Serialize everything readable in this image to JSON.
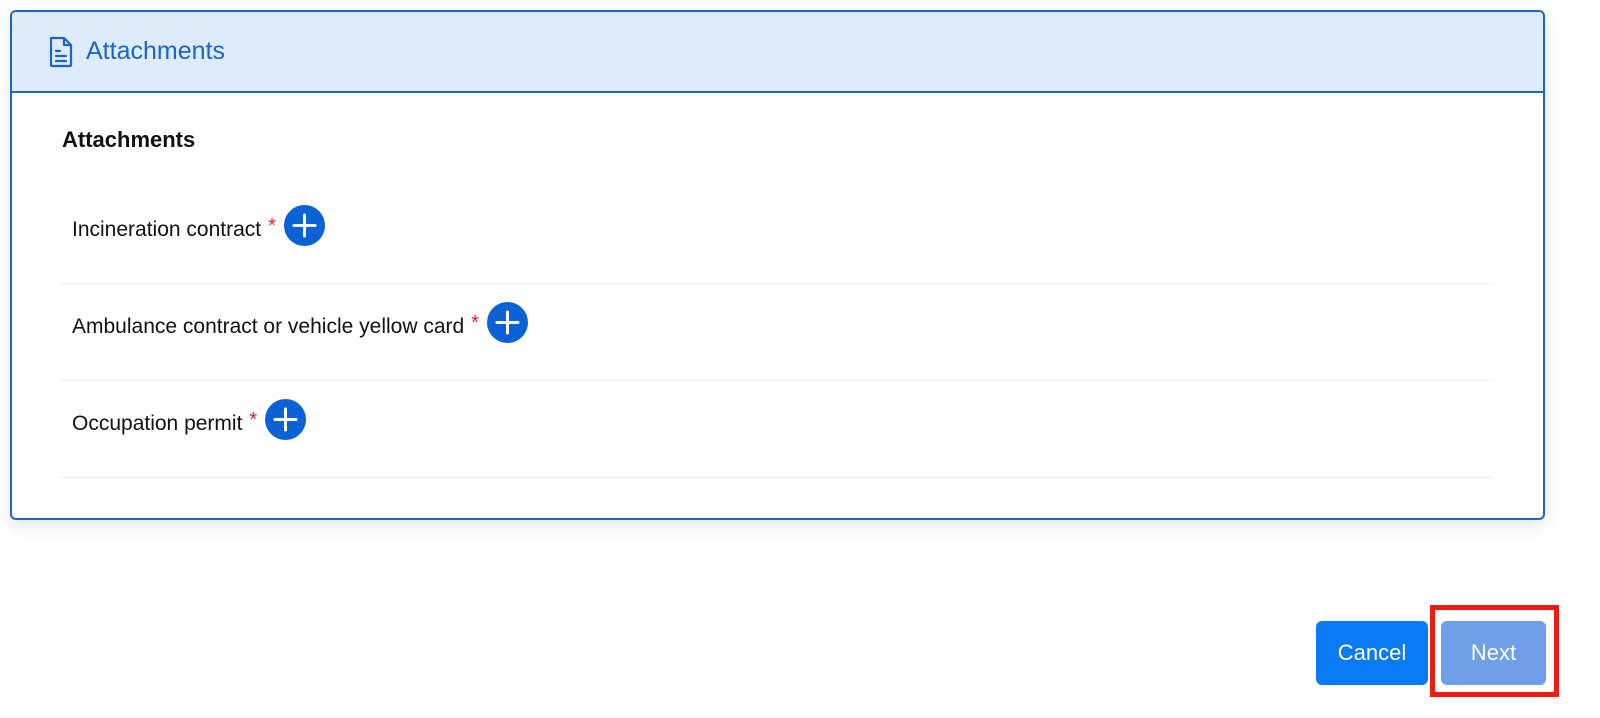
{
  "panel": {
    "header_title": "Attachments",
    "header_icon": "document-icon",
    "section_title": "Attachments"
  },
  "attachments": [
    {
      "label": "Incineration contract",
      "required_mark": "*",
      "add_icon": "plus-icon"
    },
    {
      "label": "Ambulance contract or vehicle yellow card",
      "required_mark": "*",
      "add_icon": "plus-icon"
    },
    {
      "label": "Occupation permit",
      "required_mark": "*",
      "add_icon": "plus-icon"
    }
  ],
  "actions": {
    "cancel_label": "Cancel",
    "next_label": "Next"
  },
  "colors": {
    "primary": "#1c64c8",
    "header_bg": "#deebf8",
    "cancel_bg": "#0b7af5",
    "next_bg": "#6f9fe6",
    "required": "#e0202a",
    "highlight": "#ee1b12"
  }
}
